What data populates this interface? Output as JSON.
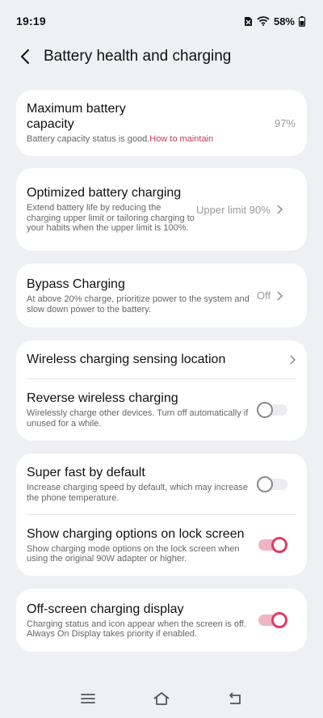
{
  "status_bar": {
    "time": "19:19",
    "battery": "58%"
  },
  "header": {
    "title": "Battery health and charging"
  },
  "capacity": {
    "title": "Maximum battery capacity",
    "desc": "Battery capacity status is good.",
    "link": "How to maintain",
    "value": "97%"
  },
  "optimized": {
    "title": "Optimized battery charging",
    "desc": "Extend battery life by reducing the charging upper limit or tailoring charging to your habits when the upper limit is 100%.",
    "value": "Upper limit 90%"
  },
  "bypass": {
    "title": "Bypass Charging",
    "desc": "At above 20% charge, prioritize power to the system and slow down power to the battery.",
    "value": "Off"
  },
  "wireless_location": {
    "title": "Wireless charging sensing location"
  },
  "reverse_wireless": {
    "title": "Reverse wireless charging",
    "desc": "Wirelessly charge other devices. Turn off automatically if unused for a while.",
    "enabled": false
  },
  "super_fast": {
    "title": "Super fast by default",
    "desc": "Increase charging speed by default, which may increase the phone temperature.",
    "enabled": false
  },
  "lock_screen_options": {
    "title": "Show charging options on lock screen",
    "desc": "Show charging mode options on the lock screen when using the original 90W adapter or higher.",
    "enabled": true
  },
  "off_screen_display": {
    "title": "Off-screen charging display",
    "desc": "Charging status and icon appear when the screen is off. Always On Display takes priority if enabled.",
    "enabled": true
  },
  "colors": {
    "accent": "#e03b68",
    "link": "#c9385b",
    "background": "#eff0f4"
  },
  "icons": {
    "back": "chevron-left-icon",
    "chevron": "chevron-right-icon",
    "nav_menu": "menu-icon",
    "nav_home": "home-icon",
    "nav_back": "back-icon"
  }
}
